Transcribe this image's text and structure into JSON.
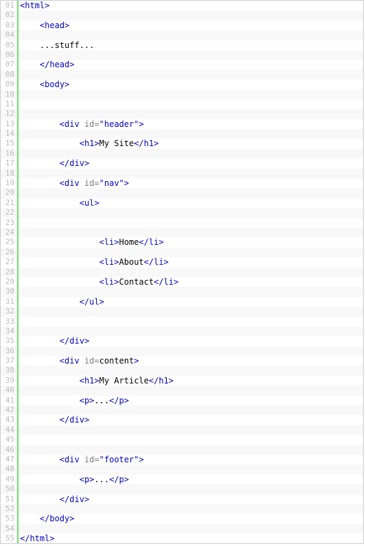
{
  "code": {
    "lines": [
      {
        "n": "01",
        "indent": 0,
        "segs": [
          {
            "t": "<",
            "c": "tag"
          },
          {
            "t": "html",
            "c": "tag"
          },
          {
            "t": ">",
            "c": "tag"
          }
        ]
      },
      {
        "n": "02",
        "indent": 0,
        "segs": []
      },
      {
        "n": "03",
        "indent": 1,
        "segs": [
          {
            "t": "<",
            "c": "tag"
          },
          {
            "t": "head",
            "c": "tag"
          },
          {
            "t": ">",
            "c": "tag"
          }
        ]
      },
      {
        "n": "04",
        "indent": 0,
        "segs": []
      },
      {
        "n": "05",
        "indent": 1,
        "segs": [
          {
            "t": "...stuff...",
            "c": ""
          }
        ]
      },
      {
        "n": "06",
        "indent": 0,
        "segs": []
      },
      {
        "n": "07",
        "indent": 1,
        "segs": [
          {
            "t": "</",
            "c": "tag"
          },
          {
            "t": "head",
            "c": "tag"
          },
          {
            "t": ">",
            "c": "tag"
          }
        ]
      },
      {
        "n": "08",
        "indent": 0,
        "segs": []
      },
      {
        "n": "09",
        "indent": 1,
        "segs": [
          {
            "t": "<",
            "c": "tag"
          },
          {
            "t": "body",
            "c": "tag"
          },
          {
            "t": ">",
            "c": "tag"
          }
        ]
      },
      {
        "n": "10",
        "indent": 0,
        "segs": []
      },
      {
        "n": "11",
        "indent": 0,
        "segs": []
      },
      {
        "n": "12",
        "indent": 0,
        "segs": []
      },
      {
        "n": "13",
        "indent": 2,
        "segs": [
          {
            "t": "<",
            "c": "tag"
          },
          {
            "t": "div",
            "c": "tag"
          },
          {
            "t": " ",
            "c": ""
          },
          {
            "t": "id",
            "c": "attr"
          },
          {
            "t": "=",
            "c": "attr"
          },
          {
            "t": "\"header\"",
            "c": "str"
          },
          {
            "t": ">",
            "c": "tag"
          }
        ]
      },
      {
        "n": "14",
        "indent": 0,
        "segs": []
      },
      {
        "n": "15",
        "indent": 3,
        "segs": [
          {
            "t": "<",
            "c": "tag"
          },
          {
            "t": "h1",
            "c": "tag"
          },
          {
            "t": ">",
            "c": "tag"
          },
          {
            "t": "My Site",
            "c": ""
          },
          {
            "t": "</",
            "c": "tag"
          },
          {
            "t": "h1",
            "c": "tag"
          },
          {
            "t": ">",
            "c": "tag"
          }
        ]
      },
      {
        "n": "16",
        "indent": 0,
        "segs": []
      },
      {
        "n": "17",
        "indent": 2,
        "segs": [
          {
            "t": "</",
            "c": "tag"
          },
          {
            "t": "div",
            "c": "tag"
          },
          {
            "t": ">",
            "c": "tag"
          }
        ]
      },
      {
        "n": "18",
        "indent": 0,
        "segs": []
      },
      {
        "n": "19",
        "indent": 2,
        "segs": [
          {
            "t": "<",
            "c": "tag"
          },
          {
            "t": "div",
            "c": "tag"
          },
          {
            "t": " ",
            "c": ""
          },
          {
            "t": "id",
            "c": "attr"
          },
          {
            "t": "=",
            "c": "attr"
          },
          {
            "t": "\"nav\"",
            "c": "str"
          },
          {
            "t": ">",
            "c": "tag"
          }
        ]
      },
      {
        "n": "20",
        "indent": 0,
        "segs": []
      },
      {
        "n": "21",
        "indent": 3,
        "segs": [
          {
            "t": "<",
            "c": "tag"
          },
          {
            "t": "ul",
            "c": "tag"
          },
          {
            "t": ">",
            "c": "tag"
          }
        ]
      },
      {
        "n": "22",
        "indent": 0,
        "segs": []
      },
      {
        "n": "23",
        "indent": 0,
        "segs": []
      },
      {
        "n": "24",
        "indent": 0,
        "segs": []
      },
      {
        "n": "25",
        "indent": 4,
        "segs": [
          {
            "t": "<",
            "c": "tag"
          },
          {
            "t": "li",
            "c": "tag"
          },
          {
            "t": ">",
            "c": "tag"
          },
          {
            "t": "Home",
            "c": ""
          },
          {
            "t": "</",
            "c": "tag"
          },
          {
            "t": "li",
            "c": "tag"
          },
          {
            "t": ">",
            "c": "tag"
          }
        ]
      },
      {
        "n": "26",
        "indent": 0,
        "segs": []
      },
      {
        "n": "27",
        "indent": 4,
        "segs": [
          {
            "t": "<",
            "c": "tag"
          },
          {
            "t": "li",
            "c": "tag"
          },
          {
            "t": ">",
            "c": "tag"
          },
          {
            "t": "About",
            "c": ""
          },
          {
            "t": "</",
            "c": "tag"
          },
          {
            "t": "li",
            "c": "tag"
          },
          {
            "t": ">",
            "c": "tag"
          }
        ]
      },
      {
        "n": "28",
        "indent": 0,
        "segs": []
      },
      {
        "n": "29",
        "indent": 4,
        "segs": [
          {
            "t": "<",
            "c": "tag"
          },
          {
            "t": "li",
            "c": "tag"
          },
          {
            "t": ">",
            "c": "tag"
          },
          {
            "t": "Contact",
            "c": ""
          },
          {
            "t": "</",
            "c": "tag"
          },
          {
            "t": "li",
            "c": "tag"
          },
          {
            "t": ">",
            "c": "tag"
          }
        ]
      },
      {
        "n": "30",
        "indent": 0,
        "segs": []
      },
      {
        "n": "31",
        "indent": 3,
        "segs": [
          {
            "t": "</",
            "c": "tag"
          },
          {
            "t": "ul",
            "c": "tag"
          },
          {
            "t": ">",
            "c": "tag"
          }
        ]
      },
      {
        "n": "32",
        "indent": 0,
        "segs": []
      },
      {
        "n": "33",
        "indent": 0,
        "segs": []
      },
      {
        "n": "34",
        "indent": 0,
        "segs": []
      },
      {
        "n": "35",
        "indent": 2,
        "segs": [
          {
            "t": "</",
            "c": "tag"
          },
          {
            "t": "div",
            "c": "tag"
          },
          {
            "t": ">",
            "c": "tag"
          }
        ]
      },
      {
        "n": "36",
        "indent": 0,
        "segs": []
      },
      {
        "n": "37",
        "indent": 2,
        "segs": [
          {
            "t": "<",
            "c": "tag"
          },
          {
            "t": "div",
            "c": "tag"
          },
          {
            "t": " ",
            "c": ""
          },
          {
            "t": "id",
            "c": "attr"
          },
          {
            "t": "=",
            "c": "attr"
          },
          {
            "t": "content",
            "c": ""
          },
          {
            "t": ">",
            "c": "tag"
          }
        ]
      },
      {
        "n": "38",
        "indent": 0,
        "segs": []
      },
      {
        "n": "39",
        "indent": 3,
        "segs": [
          {
            "t": "<",
            "c": "tag"
          },
          {
            "t": "h1",
            "c": "tag"
          },
          {
            "t": ">",
            "c": "tag"
          },
          {
            "t": "My Article",
            "c": ""
          },
          {
            "t": "</",
            "c": "tag"
          },
          {
            "t": "h1",
            "c": "tag"
          },
          {
            "t": ">",
            "c": "tag"
          }
        ]
      },
      {
        "n": "40",
        "indent": 0,
        "segs": []
      },
      {
        "n": "41",
        "indent": 3,
        "segs": [
          {
            "t": "<",
            "c": "tag"
          },
          {
            "t": "p",
            "c": "tag"
          },
          {
            "t": ">",
            "c": "tag"
          },
          {
            "t": "...",
            "c": ""
          },
          {
            "t": "</",
            "c": "tag"
          },
          {
            "t": "p",
            "c": "tag"
          },
          {
            "t": ">",
            "c": "tag"
          }
        ]
      },
      {
        "n": "42",
        "indent": 0,
        "segs": []
      },
      {
        "n": "43",
        "indent": 2,
        "segs": [
          {
            "t": "</",
            "c": "tag"
          },
          {
            "t": "div",
            "c": "tag"
          },
          {
            "t": ">",
            "c": "tag"
          }
        ]
      },
      {
        "n": "44",
        "indent": 0,
        "segs": []
      },
      {
        "n": "45",
        "indent": 0,
        "segs": []
      },
      {
        "n": "46",
        "indent": 0,
        "segs": []
      },
      {
        "n": "47",
        "indent": 2,
        "segs": [
          {
            "t": "<",
            "c": "tag"
          },
          {
            "t": "div",
            "c": "tag"
          },
          {
            "t": " ",
            "c": ""
          },
          {
            "t": "id",
            "c": "attr"
          },
          {
            "t": "=",
            "c": "attr"
          },
          {
            "t": "\"footer\"",
            "c": "str"
          },
          {
            "t": ">",
            "c": "tag"
          }
        ]
      },
      {
        "n": "48",
        "indent": 0,
        "segs": []
      },
      {
        "n": "49",
        "indent": 3,
        "segs": [
          {
            "t": "<",
            "c": "tag"
          },
          {
            "t": "p",
            "c": "tag"
          },
          {
            "t": ">",
            "c": "tag"
          },
          {
            "t": "...",
            "c": ""
          },
          {
            "t": "</",
            "c": "tag"
          },
          {
            "t": "p",
            "c": "tag"
          },
          {
            "t": ">",
            "c": "tag"
          }
        ]
      },
      {
        "n": "50",
        "indent": 0,
        "segs": []
      },
      {
        "n": "51",
        "indent": 2,
        "segs": [
          {
            "t": "</",
            "c": "tag"
          },
          {
            "t": "div",
            "c": "tag"
          },
          {
            "t": ">",
            "c": "tag"
          }
        ]
      },
      {
        "n": "52",
        "indent": 0,
        "segs": []
      },
      {
        "n": "53",
        "indent": 1,
        "segs": [
          {
            "t": "</",
            "c": "tag"
          },
          {
            "t": "body",
            "c": "tag"
          },
          {
            "t": ">",
            "c": "tag"
          }
        ]
      },
      {
        "n": "54",
        "indent": 0,
        "segs": []
      },
      {
        "n": "55",
        "indent": 0,
        "segs": [
          {
            "t": "</",
            "c": "tag"
          },
          {
            "t": "html",
            "c": "tag"
          },
          {
            "t": ">",
            "c": "tag"
          }
        ]
      }
    ]
  },
  "indent_unit": "    "
}
